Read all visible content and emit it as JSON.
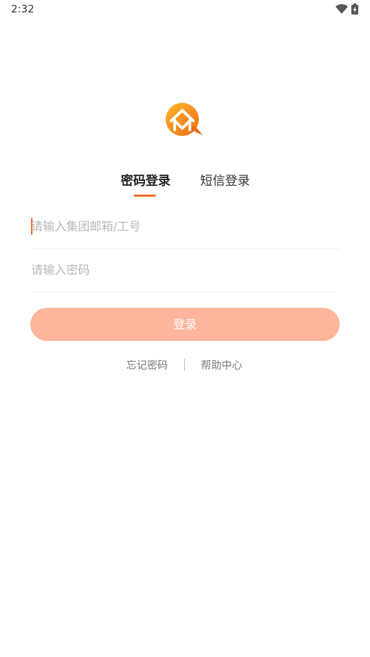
{
  "status_bar": {
    "time": "2:32",
    "wifi_icon": "wifi-icon",
    "battery_icon": "battery-charging-icon"
  },
  "logo": {
    "icon": "house-chat-logo",
    "colors": {
      "primary": "#F9A21B",
      "secondary": "#F06A1E"
    }
  },
  "tabs": [
    {
      "label": "密码登录",
      "active": true
    },
    {
      "label": "短信登录",
      "active": false
    }
  ],
  "form": {
    "account_placeholder": "请输入集团邮箱/工号",
    "password_placeholder": "请输入密码",
    "login_label": "登录"
  },
  "links": {
    "forgot": "忘记密码",
    "help": "帮助中心"
  },
  "colors": {
    "accent": "#F06A1E",
    "button": "#FFB59C",
    "placeholder": "#B8B8B8"
  }
}
